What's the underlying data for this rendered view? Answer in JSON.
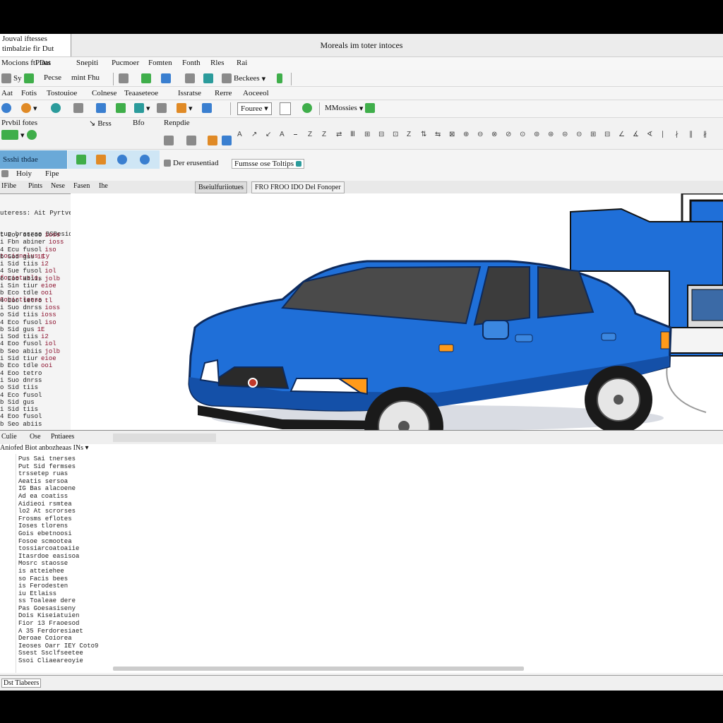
{
  "window": {
    "title": "Moreals im toter intoces",
    "corner_lines": [
      "Jouval iftesses",
      "timbalzie fir Dut",
      "Mocions ftl Dat"
    ]
  },
  "menubar": [
    "Pints",
    "Snepiti",
    "Pucmoer",
    "Fomten",
    "Fonth",
    "Rles",
    "Rai"
  ],
  "toolbar1": {
    "left_label": "Sy",
    "label_a": "Pecse",
    "label_b": "mint Fhu",
    "dropdown": "Beckees"
  },
  "menu2": [
    "Aat",
    "Fotis",
    "Tostouioe",
    "Colnese",
    "Teaaseteoe",
    "Issratse",
    "Rerre",
    "Aoceeol"
  ],
  "toolbar2": {
    "dropdown_a": "Fouree",
    "dropdown_b": "MMossies"
  },
  "toolbar3": {
    "left": "Prvbil fotes",
    "search_a": "Brss",
    "search_b": "Bfo",
    "search_c": "Renpdie"
  },
  "toolbar4": {
    "button_a": "Der erusentiad",
    "button_b": "Fumsse ose Toltips"
  },
  "side_panel": {
    "selected_item": "Ssshi thdae",
    "footer_a": "Hoiy",
    "footer_b": "Fipe"
  },
  "main_tabs": {
    "plain": [
      "IFibe",
      "Pints",
      "Nese",
      "Fasen",
      "Ihe"
    ],
    "tab_a": "Bseiulfuriiotues",
    "tab_b": "FRO FROO IDO Del Fonoper"
  },
  "code_header": [
    "uteress: Ait Pyrtvesns BlE Fous coiiunay",
    "tuo brssrse BSBesidde tc tur ape"
  ],
  "code_red": [
    "tocisnalus ty",
    "focietuslo,",
    "Gobirtlenss"
  ],
  "code_lines": [
    [
      "t Eoy oteoo",
      "i Fbn abiner",
      "4 Ecu fusol",
      "b Sod gus",
      "i Sid tiis",
      "4 Sue fusol",
      "o Eoo abiis",
      "i Sin tiur",
      "b Eco tdle",
      "4 Eoo tetro",
      "i Suo dnrss",
      "o Sid tiis",
      "4 Eco fusol",
      "b Sid gus",
      "i Sod tiis",
      "4 Eoo fusol",
      "b Seo abiis",
      "i Sid tiur",
      "b Eco tdle",
      "4 Eoo tetro",
      "i Suo dnrss",
      "o Sid tiis",
      "4 Eco fusol",
      "b Sid gus",
      "i Sid tiis",
      "4 Eoo fusol",
      "b Seo abiis"
    ],
    [
      "ioss",
      "ioss",
      "iso",
      "1E",
      "i2",
      "iol",
      "jolb",
      "eioe",
      "ooi",
      "tl",
      "ioss",
      "ioss",
      "iso",
      "1E",
      "i2",
      "iol",
      "jolb",
      "eioe",
      "ooi"
    ]
  ],
  "lower": {
    "bar_items": [
      "Culie",
      "Ose",
      "Pntiaees"
    ],
    "tab": "Aniofed  Biot anbozheaas INs",
    "lines": [
      "Pus Sai tnerses",
      "Put Sid fermses",
      "trssetep ruas",
      "Aeatis sersoa",
      "IG Bas alacoene",
      "Ad ea coatiss",
      "Aidieoi rsmtea",
      "lo2 At scrorses",
      "Frosms eflotes",
      "Ioses tlorens",
      "Gois ebetnoosi",
      "Fosoe scmootea",
      "tossiarcoatoaiie",
      "Itasrdoe easisoa",
      "Mosrc staosse",
      "is atteiehee",
      "so Facis bees",
      "is Ferodesten",
      "iu Etlaiss",
      "ss Toaleae dere",
      "Pas Goesasiseny",
      "Dois Kiseiatuien",
      "Fior 13 Fraoesod",
      "A 35 Ferdoresiaet",
      "Deroae Coiorea",
      "Ieoses Oarr IEY Coto9",
      "Ssest Ssclfseetee",
      "Ssoi Cliaeareoyie"
    ]
  },
  "status": "Dst Tiabeers",
  "colors": {
    "car_body": "#1f6fd8",
    "car_dark": "#1450a8",
    "selection": "#6aa9d8",
    "code_accent": "#8b0f2c"
  }
}
